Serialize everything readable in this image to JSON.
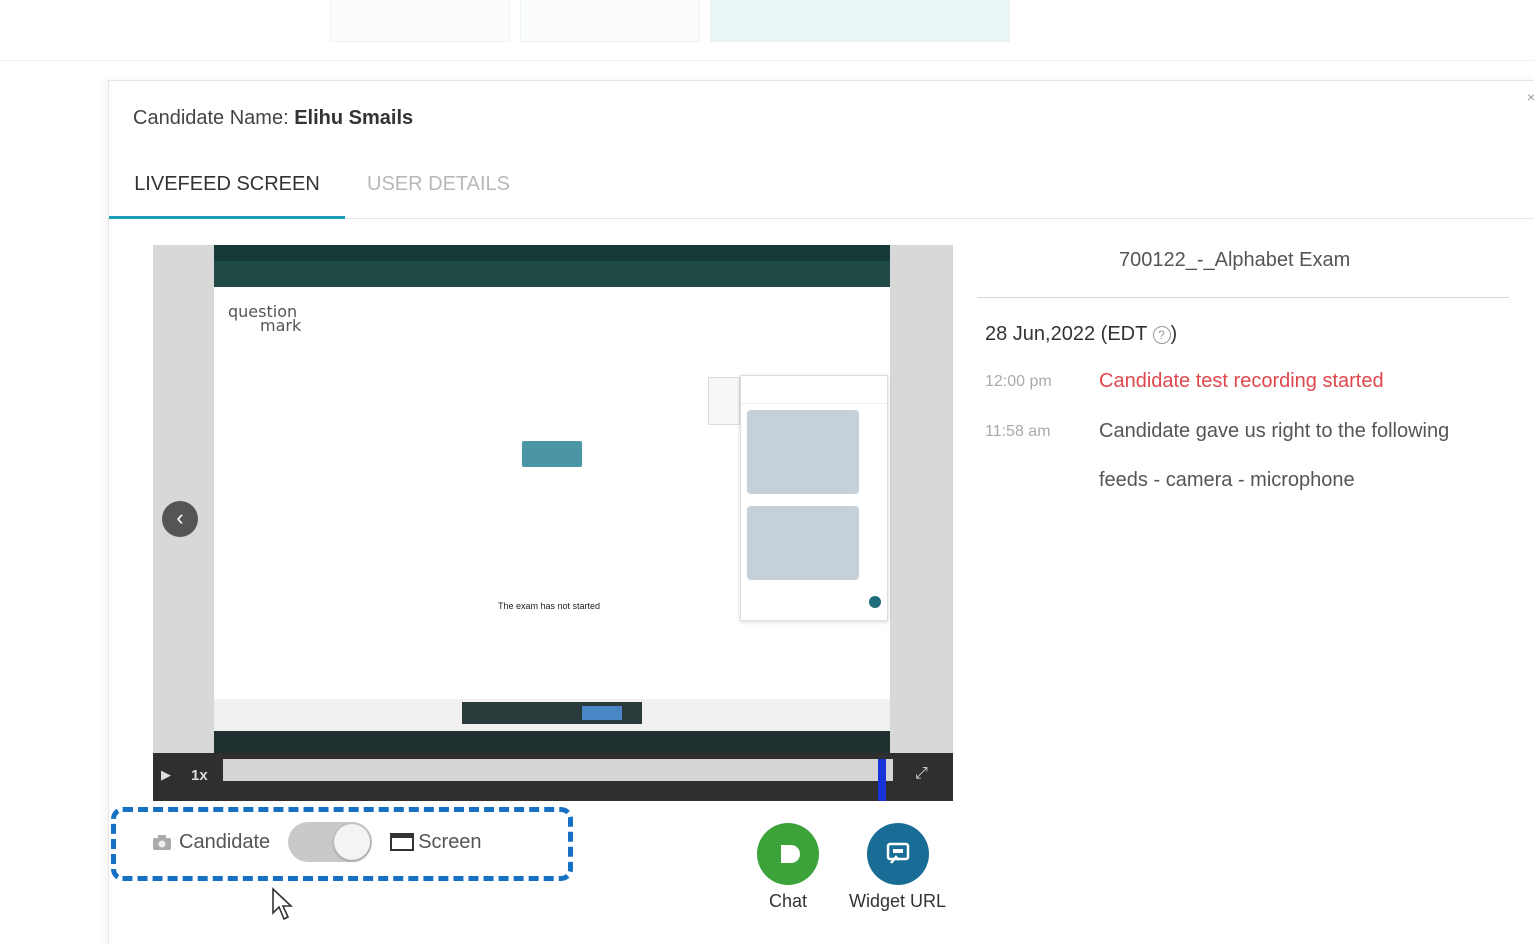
{
  "modal": {
    "close": "×",
    "candidate_label": "Candidate Name:",
    "candidate_name": "Elihu Smails",
    "tabs": [
      {
        "label": "LIVEFEED SCREEN",
        "active": true
      },
      {
        "label": "USER DETAILS",
        "active": false
      }
    ]
  },
  "player": {
    "inner_screen": {
      "logo_line1": "question",
      "logo_line2": "mark",
      "status_text": "The exam has not started"
    },
    "speed": "1x",
    "progress": 0.99
  },
  "feed_toggle": {
    "left_label": "Candidate",
    "right_label": "Screen",
    "selected": "Screen"
  },
  "actions": {
    "chat_label": "Chat",
    "widget_label": "Widget URL"
  },
  "right_panel": {
    "exam_title": "700122_-_Alphabet Exam",
    "date": "28 Jun,2022 (EDT",
    "date_close": ")",
    "logs": [
      {
        "time": "12:00 pm",
        "message": "Candidate test recording started",
        "highlight": true
      },
      {
        "time": "11:58 am",
        "message": "Candidate gave us right to the following",
        "highlight": false
      }
    ],
    "log_continuation": "feeds - camera - microphone"
  },
  "colors": {
    "accent": "#1a9fb5",
    "chat_green": "#3ca33a",
    "widget_blue": "#186c95",
    "alert_red": "#e0474c",
    "highlight_dash": "#1670c4"
  }
}
